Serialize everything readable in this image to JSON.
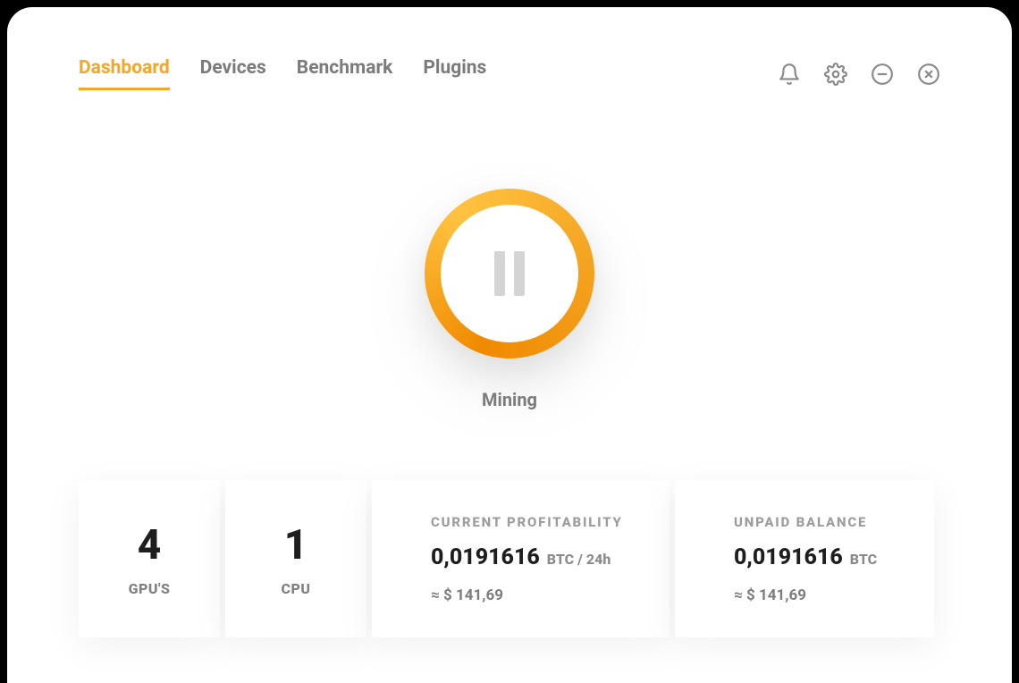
{
  "tabs": {
    "dashboard": "Dashboard",
    "devices": "Devices",
    "benchmark": "Benchmark",
    "plugins": "Plugins"
  },
  "status": {
    "label": "Mining"
  },
  "stats": {
    "gpu": {
      "count": "4",
      "label": "GPU'S"
    },
    "cpu": {
      "count": "1",
      "label": "CPU"
    },
    "profitability": {
      "title": "CURRENT PROFITABILITY",
      "value": "0,0191616",
      "unit": "BTC  / 24h",
      "approx": "≈ $ 141,69"
    },
    "balance": {
      "title": "UNPAID BALANCE",
      "value": "0,0191616",
      "unit": "BTC",
      "approx": "≈ $ 141,69"
    }
  }
}
